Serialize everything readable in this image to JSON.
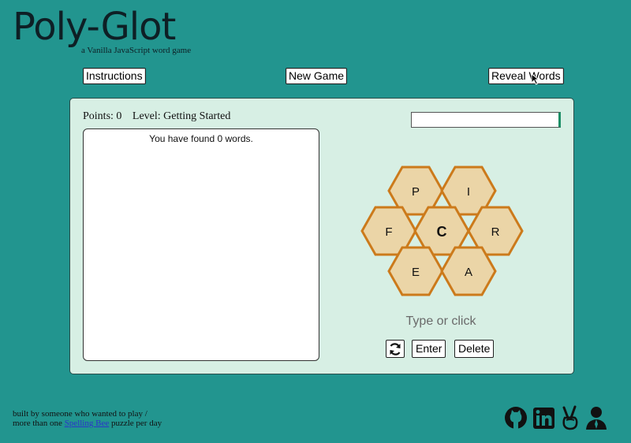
{
  "app": {
    "title": "Poly-Glot",
    "subtitle": "a Vanilla JavaScript word game"
  },
  "toolbar": {
    "instructions_label": "Instructions",
    "new_game_label": "New Game",
    "reveal_label": "Reveal Words"
  },
  "stats": {
    "points": "Points: 0",
    "level": "Level: Getting Started"
  },
  "words": {
    "found_message": "You have found 0 words."
  },
  "input": {
    "value": ""
  },
  "hive": {
    "center": "C",
    "outer": [
      "P",
      "I",
      "F",
      "R",
      "E",
      "A"
    ],
    "fill_color": "#ebd5a7",
    "stroke_color": "#cc7a1b"
  },
  "controls": {
    "prompt": "Type or click",
    "enter_label": "Enter",
    "delete_label": "Delete",
    "shuffle_icon": "refresh-icon"
  },
  "footer": {
    "line1": "built by someone who wanted to play /",
    "line2_prefix": "more than one ",
    "link_text": "Spelling Bee",
    "line2_suffix": " puzzle per day",
    "icons": [
      "github-icon",
      "linkedin-icon",
      "peace-hand-icon",
      "person-icon"
    ]
  }
}
